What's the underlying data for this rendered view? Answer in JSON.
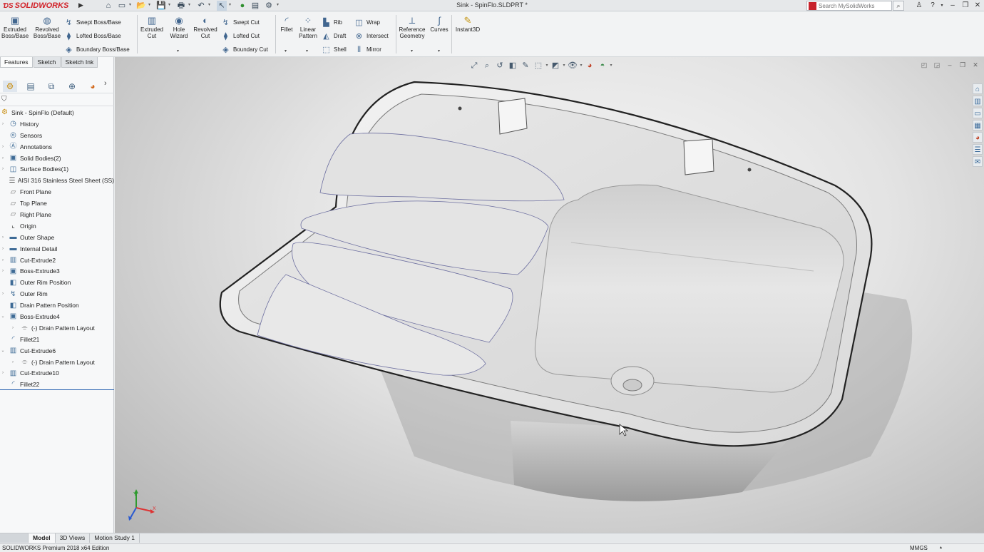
{
  "app": {
    "brand": "SOLIDWORKS",
    "document_title": "Sink - SpinFlo.SLDPRT *",
    "search_placeholder": "Search MySolidWorks",
    "edition": "SOLIDWORKS Premium 2018 x64 Edition",
    "units": "MMGS"
  },
  "quick_access": [
    "home-icon",
    "new-icon",
    "open-icon",
    "save-icon",
    "print-icon",
    "undo-icon",
    "select-icon",
    "rebuild-icon",
    "file-properties-icon",
    "options-icon"
  ],
  "command_manager": {
    "large": [
      {
        "label": "Extruded Boss/Base"
      },
      {
        "label": "Revolved Boss/Base"
      },
      {
        "label": "Extruded Cut"
      },
      {
        "label": "Hole Wizard"
      },
      {
        "label": "Revolved Cut"
      },
      {
        "label": "Fillet"
      },
      {
        "label": "Linear Pattern"
      },
      {
        "label": "Reference Geometry"
      },
      {
        "label": "Curves"
      },
      {
        "label": "Instant3D"
      }
    ],
    "small": [
      {
        "label": "Swept Boss/Base"
      },
      {
        "label": "Lofted Boss/Base"
      },
      {
        "label": "Boundary Boss/Base"
      },
      {
        "label": "Swept Cut"
      },
      {
        "label": "Lofted Cut"
      },
      {
        "label": "Boundary Cut"
      },
      {
        "label": "Rib"
      },
      {
        "label": "Draft"
      },
      {
        "label": "Shell"
      },
      {
        "label": "Wrap"
      },
      {
        "label": "Intersect"
      },
      {
        "label": "Mirror"
      }
    ]
  },
  "panel_tabs": [
    "Features",
    "Sketch",
    "Sketch Ink"
  ],
  "feature_tree": [
    {
      "label": "Sink - SpinFlo  (Default)"
    },
    {
      "label": "History"
    },
    {
      "label": "Sensors"
    },
    {
      "label": "Annotations"
    },
    {
      "label": "Solid Bodies(2)"
    },
    {
      "label": "Surface Bodies(1)"
    },
    {
      "label": "AISI 316 Stainless Steel Sheet (SS)"
    },
    {
      "label": "Front Plane"
    },
    {
      "label": "Top Plane"
    },
    {
      "label": "Right Plane"
    },
    {
      "label": "Origin"
    },
    {
      "label": "Outer Shape"
    },
    {
      "label": "Internal Detail"
    },
    {
      "label": "Cut-Extrude2"
    },
    {
      "label": "Boss-Extrude3"
    },
    {
      "label": "Outer Rim Position"
    },
    {
      "label": "Outer Rim"
    },
    {
      "label": "Drain Pattern Position"
    },
    {
      "label": "Boss-Extrude4"
    },
    {
      "label": "(-) Drain Pattern Layout"
    },
    {
      "label": "Fillet21"
    },
    {
      "label": "Cut-Extrude6"
    },
    {
      "label": "(-) Drain Pattern Layout"
    },
    {
      "label": "Cut-Extrude10"
    },
    {
      "label": "Fillet22"
    }
  ],
  "bottom_tabs": [
    "Model",
    "3D Views",
    "Motion Study 1"
  ],
  "triad": {
    "x": "X",
    "y": "Y"
  }
}
